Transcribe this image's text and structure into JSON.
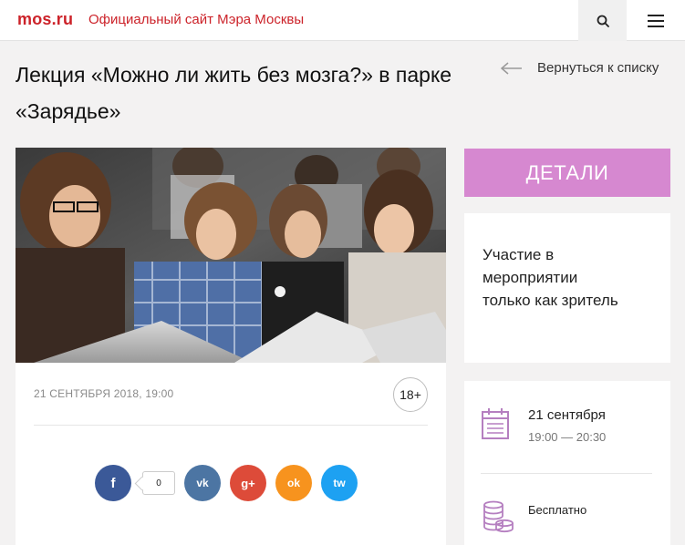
{
  "header": {
    "logo": "mos.ru",
    "site_title": "Официальный сайт Мэра Москвы",
    "search_icon": "search-icon",
    "menu_icon": "hamburger-icon"
  },
  "event": {
    "title": "Лекция «Можно ли жить без мозга?» в парке «Зарядье»",
    "back_label": "Вернуться к списку",
    "date_text": "21 СЕНТЯБРЯ 2018, 19:00",
    "age_rating": "18+",
    "share_count": "0"
  },
  "social": {
    "facebook": "f",
    "vk": "vk",
    "gplus": "g+",
    "ok": "ok",
    "twitter": "tw"
  },
  "sidebar": {
    "details_label": "ДЕТАЛИ",
    "participation_text": "Участие в мероприятии только как зритель",
    "date": "21 сентября",
    "time": "19:00 — 20:30",
    "price": "Бесплатно"
  },
  "colors": {
    "brand": "#cc2229",
    "details_bg": "#d688d0",
    "icon_accent": "#b57fc0"
  }
}
